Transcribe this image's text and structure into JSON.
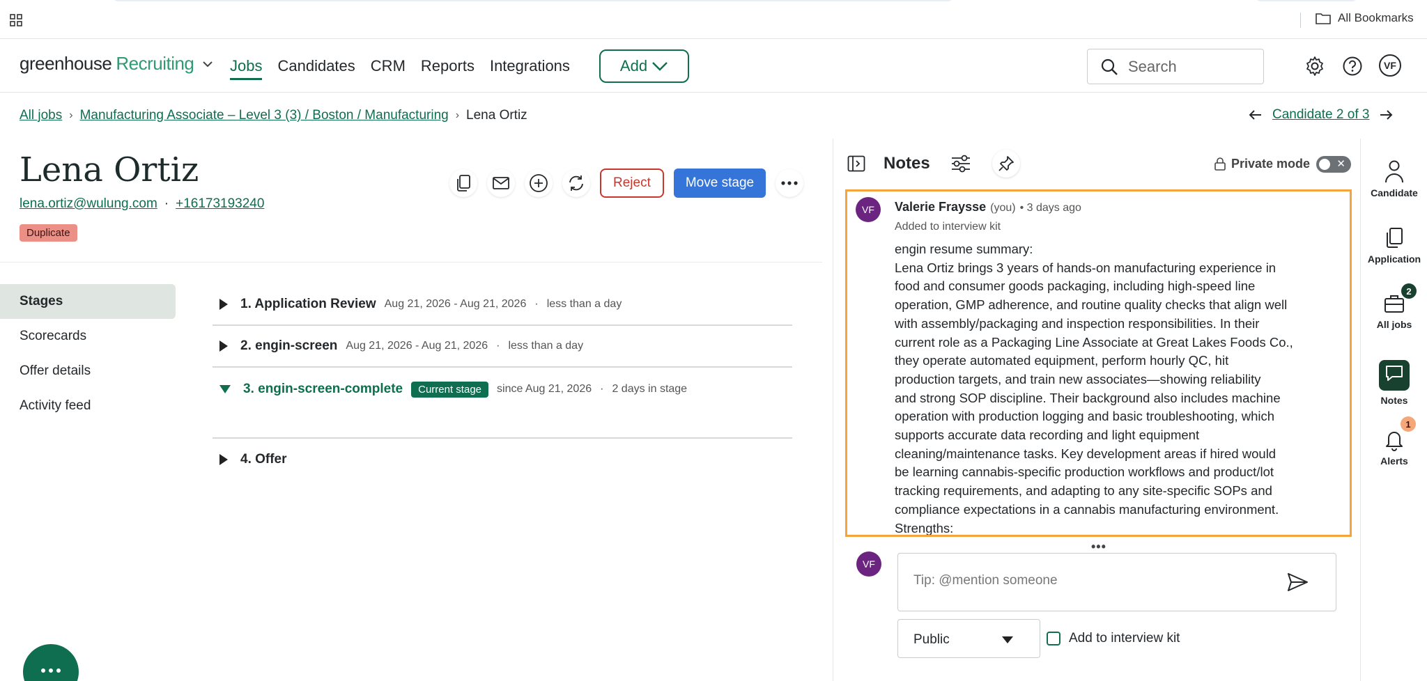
{
  "browser": {
    "bookmarks_label": "All Bookmarks"
  },
  "nav": {
    "logo_main": "greenhouse",
    "logo_sub": "Recruiting",
    "links": [
      "Jobs",
      "Candidates",
      "CRM",
      "Reports",
      "Integrations"
    ],
    "add_label": "Add",
    "search_placeholder": "Search",
    "user_initials": "VF"
  },
  "breadcrumb": {
    "all_jobs": "All jobs",
    "job": "Manufacturing Associate – Level 3 (3) / Boston / Manufacturing",
    "current": "Lena Ortiz",
    "pager": "Candidate 2 of 3"
  },
  "candidate": {
    "name": "Lena Ortiz",
    "email": "lena.ortiz@wulung.com",
    "phone": "+16173193240",
    "badge": "Duplicate",
    "reject_label": "Reject",
    "move_stage_label": "Move stage"
  },
  "sidenav": [
    "Stages",
    "Scorecards",
    "Offer details",
    "Activity feed"
  ],
  "stages": [
    {
      "title": "1. Application Review",
      "dates": "Aug 21, 2026 - Aug 21, 2026",
      "duration": "less than a day"
    },
    {
      "title": "2. engin-screen",
      "dates": "Aug 21, 2026 - Aug 21, 2026",
      "duration": "less than a day"
    },
    {
      "title": "3. engin-screen-complete",
      "badge": "Current stage",
      "dates": "since Aug 21, 2026",
      "duration": "2 days in stage"
    },
    {
      "title": "4. Offer"
    }
  ],
  "notes": {
    "title": "Notes",
    "private_mode": "Private mode",
    "note": {
      "initials": "VF",
      "author": "Valerie Fraysse",
      "you": "(you)",
      "ago": "• 3 days ago",
      "sub": "Added to interview kit",
      "lines": [
        "engin resume summary:",
        "Lena Ortiz brings 3 years of hands-on manufacturing experience in",
        "food and consumer goods packaging, including high-speed line",
        "operation, GMP adherence, and routine quality checks that align well",
        "with assembly/packaging and inspection responsibilities. In their",
        "current role as a Packaging Line Associate at Great Lakes Foods Co.,",
        "they operate automated equipment, perform hourly QC, hit",
        "production targets, and train new associates—showing reliability",
        "and strong SOP discipline. Their background also includes machine",
        "operation with production logging and basic troubleshooting, which",
        "supports accurate data recording and light equipment",
        "cleaning/maintenance tasks. Key development areas if hired would",
        "be learning cannabis-specific production workflows and product/lot",
        "tracking requirements, and adapting to any site-specific SOPs and",
        "compliance expectations in a cannabis manufacturing environment.",
        "Strengths:"
      ]
    },
    "composer": {
      "initials": "VF",
      "placeholder": "Tip: @mention someone",
      "visibility": "Public",
      "kit_label": "Add to interview kit"
    }
  },
  "rail": {
    "candidate": "Candidate",
    "application": "Application",
    "all_jobs": "All jobs",
    "all_jobs_count": "2",
    "notes": "Notes",
    "alerts": "Alerts",
    "alerts_count": "1"
  }
}
